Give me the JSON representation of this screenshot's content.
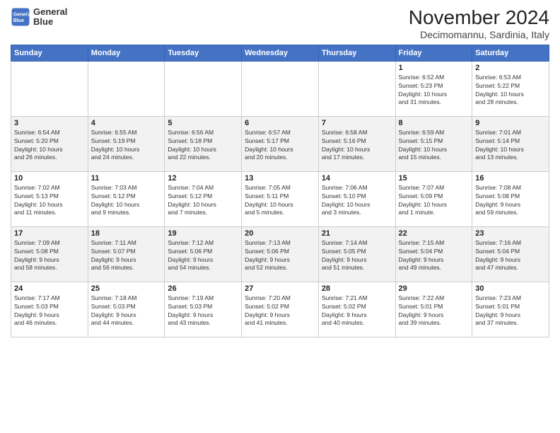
{
  "logo": {
    "line1": "General",
    "line2": "Blue"
  },
  "title": "November 2024",
  "subtitle": "Decimomannu, Sardinia, Italy",
  "weekdays": [
    "Sunday",
    "Monday",
    "Tuesday",
    "Wednesday",
    "Thursday",
    "Friday",
    "Saturday"
  ],
  "weeks": [
    [
      {
        "day": "",
        "info": ""
      },
      {
        "day": "",
        "info": ""
      },
      {
        "day": "",
        "info": ""
      },
      {
        "day": "",
        "info": ""
      },
      {
        "day": "",
        "info": ""
      },
      {
        "day": "1",
        "info": "Sunrise: 6:52 AM\nSunset: 5:23 PM\nDaylight: 10 hours\nand 31 minutes."
      },
      {
        "day": "2",
        "info": "Sunrise: 6:53 AM\nSunset: 5:22 PM\nDaylight: 10 hours\nand 28 minutes."
      }
    ],
    [
      {
        "day": "3",
        "info": "Sunrise: 6:54 AM\nSunset: 5:20 PM\nDaylight: 10 hours\nand 26 minutes."
      },
      {
        "day": "4",
        "info": "Sunrise: 6:55 AM\nSunset: 5:19 PM\nDaylight: 10 hours\nand 24 minutes."
      },
      {
        "day": "5",
        "info": "Sunrise: 6:56 AM\nSunset: 5:18 PM\nDaylight: 10 hours\nand 22 minutes."
      },
      {
        "day": "6",
        "info": "Sunrise: 6:57 AM\nSunset: 5:17 PM\nDaylight: 10 hours\nand 20 minutes."
      },
      {
        "day": "7",
        "info": "Sunrise: 6:58 AM\nSunset: 5:16 PM\nDaylight: 10 hours\nand 17 minutes."
      },
      {
        "day": "8",
        "info": "Sunrise: 6:59 AM\nSunset: 5:15 PM\nDaylight: 10 hours\nand 15 minutes."
      },
      {
        "day": "9",
        "info": "Sunrise: 7:01 AM\nSunset: 5:14 PM\nDaylight: 10 hours\nand 13 minutes."
      }
    ],
    [
      {
        "day": "10",
        "info": "Sunrise: 7:02 AM\nSunset: 5:13 PM\nDaylight: 10 hours\nand 11 minutes."
      },
      {
        "day": "11",
        "info": "Sunrise: 7:03 AM\nSunset: 5:12 PM\nDaylight: 10 hours\nand 9 minutes."
      },
      {
        "day": "12",
        "info": "Sunrise: 7:04 AM\nSunset: 5:12 PM\nDaylight: 10 hours\nand 7 minutes."
      },
      {
        "day": "13",
        "info": "Sunrise: 7:05 AM\nSunset: 5:11 PM\nDaylight: 10 hours\nand 5 minutes."
      },
      {
        "day": "14",
        "info": "Sunrise: 7:06 AM\nSunset: 5:10 PM\nDaylight: 10 hours\nand 3 minutes."
      },
      {
        "day": "15",
        "info": "Sunrise: 7:07 AM\nSunset: 5:09 PM\nDaylight: 10 hours\nand 1 minute."
      },
      {
        "day": "16",
        "info": "Sunrise: 7:08 AM\nSunset: 5:08 PM\nDaylight: 9 hours\nand 59 minutes."
      }
    ],
    [
      {
        "day": "17",
        "info": "Sunrise: 7:09 AM\nSunset: 5:08 PM\nDaylight: 9 hours\nand 58 minutes."
      },
      {
        "day": "18",
        "info": "Sunrise: 7:11 AM\nSunset: 5:07 PM\nDaylight: 9 hours\nand 56 minutes."
      },
      {
        "day": "19",
        "info": "Sunrise: 7:12 AM\nSunset: 5:06 PM\nDaylight: 9 hours\nand 54 minutes."
      },
      {
        "day": "20",
        "info": "Sunrise: 7:13 AM\nSunset: 5:06 PM\nDaylight: 9 hours\nand 52 minutes."
      },
      {
        "day": "21",
        "info": "Sunrise: 7:14 AM\nSunset: 5:05 PM\nDaylight: 9 hours\nand 51 minutes."
      },
      {
        "day": "22",
        "info": "Sunrise: 7:15 AM\nSunset: 5:04 PM\nDaylight: 9 hours\nand 49 minutes."
      },
      {
        "day": "23",
        "info": "Sunrise: 7:16 AM\nSunset: 5:04 PM\nDaylight: 9 hours\nand 47 minutes."
      }
    ],
    [
      {
        "day": "24",
        "info": "Sunrise: 7:17 AM\nSunset: 5:03 PM\nDaylight: 9 hours\nand 46 minutes."
      },
      {
        "day": "25",
        "info": "Sunrise: 7:18 AM\nSunset: 5:03 PM\nDaylight: 9 hours\nand 44 minutes."
      },
      {
        "day": "26",
        "info": "Sunrise: 7:19 AM\nSunset: 5:03 PM\nDaylight: 9 hours\nand 43 minutes."
      },
      {
        "day": "27",
        "info": "Sunrise: 7:20 AM\nSunset: 5:02 PM\nDaylight: 9 hours\nand 41 minutes."
      },
      {
        "day": "28",
        "info": "Sunrise: 7:21 AM\nSunset: 5:02 PM\nDaylight: 9 hours\nand 40 minutes."
      },
      {
        "day": "29",
        "info": "Sunrise: 7:22 AM\nSunset: 5:01 PM\nDaylight: 9 hours\nand 39 minutes."
      },
      {
        "day": "30",
        "info": "Sunrise: 7:23 AM\nSunset: 5:01 PM\nDaylight: 9 hours\nand 37 minutes."
      }
    ]
  ]
}
